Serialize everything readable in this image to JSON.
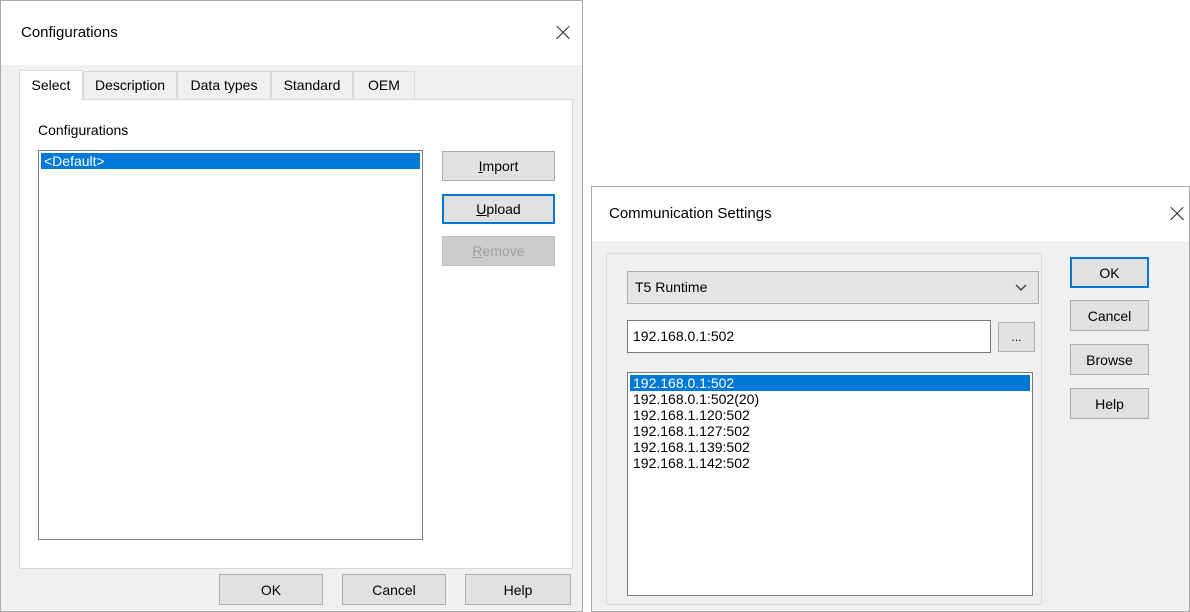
{
  "configurations_dialog": {
    "title": "Configurations",
    "tabs": [
      "Select",
      "Description",
      "Data types",
      "Standard",
      "OEM"
    ],
    "list_label": "Configurations",
    "list_items": [
      "<Default>"
    ],
    "buttons": {
      "import_u": "I",
      "import_rest": "mport",
      "upload_u": "U",
      "upload_rest": "pload",
      "remove_u": "R",
      "remove_rest": "emove"
    },
    "footer": {
      "ok": "OK",
      "cancel": "Cancel",
      "help": "Help"
    }
  },
  "communication_dialog": {
    "title": "Communication Settings",
    "runtime_select": "T5 Runtime",
    "address_input": "192.168.0.1:502",
    "browse_dots": "...",
    "address_list": [
      "192.168.0.1:502",
      "192.168.0.1:502(20)",
      "192.168.1.120:502",
      "192.168.1.127:502",
      "192.168.1.139:502",
      "192.168.1.142:502"
    ],
    "buttons": {
      "ok": "OK",
      "cancel": "Cancel",
      "browse": "Browse",
      "help": "Help"
    }
  },
  "colors": {
    "selection": "#0078d7",
    "dialog_bg": "#f0f0f0"
  }
}
